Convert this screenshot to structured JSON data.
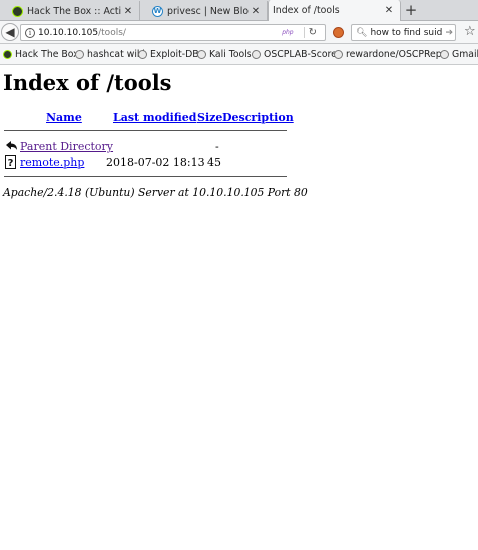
{
  "browser": {
    "tabs": [
      {
        "title": "Hack The Box :: Activ...",
        "icon": "hackthebox-icon"
      },
      {
        "title": "privesc | New Blog U...",
        "icon": "wordpress-icon"
      },
      {
        "title": "Index of /tools",
        "active": true
      }
    ],
    "new_tab_label": "+",
    "url_host": "10.10.10.105",
    "url_path": "/tools/",
    "url_badge": "php",
    "search_text": "how to find suid files"
  },
  "bookmarks": [
    {
      "label": "Hack The Box"
    },
    {
      "label": "hashcat wiki"
    },
    {
      "label": "Exploit-DB"
    },
    {
      "label": "Kali Tools"
    },
    {
      "label": "OSCPLAB-Score"
    },
    {
      "label": "rewardone/OSCPRepo"
    },
    {
      "label": "Gmail"
    }
  ],
  "page": {
    "heading": "Index of /tools",
    "columns": {
      "name": "Name",
      "last_modified": "Last modified",
      "size": "Size",
      "description": "Description"
    },
    "rows": [
      {
        "name": "Parent Directory",
        "last_modified": "",
        "size": "-",
        "description": "",
        "icon": "back-folder-icon"
      },
      {
        "name": "remote.php",
        "last_modified": "2018-07-02 18:13",
        "size": "45",
        "description": "",
        "icon": "unknown-file-icon"
      }
    ],
    "address": "Apache/2.4.18 (Ubuntu) Server at 10.10.10.105 Port 80"
  },
  "colors": {
    "link": "#0000ee",
    "visited_link": "#551a8b"
  }
}
